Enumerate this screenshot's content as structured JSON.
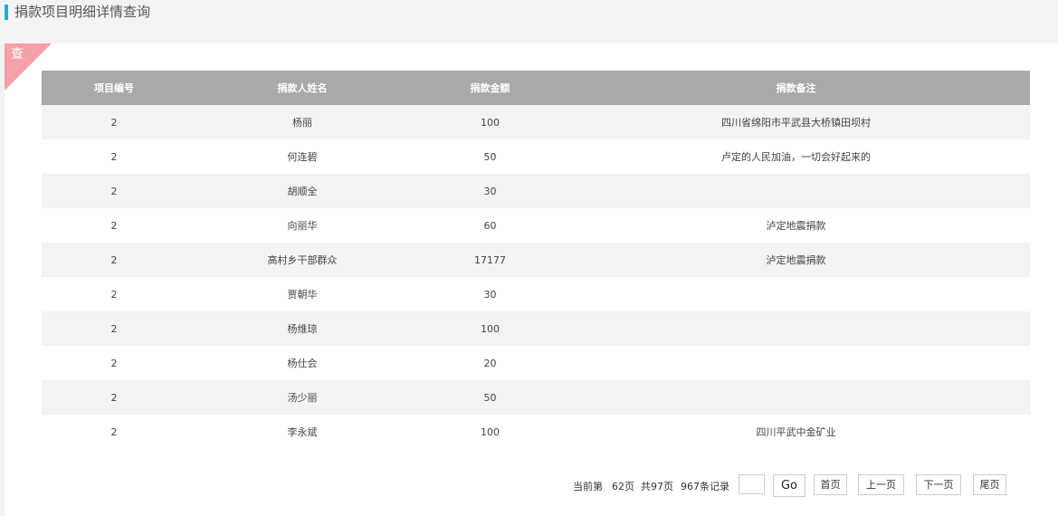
{
  "page": {
    "title": "捐款项目明细详情查询"
  },
  "panel": {
    "corner_label": "查"
  },
  "table": {
    "headers": [
      "项目编号",
      "捐款人姓名",
      "捐款金额",
      "捐款备注"
    ],
    "rows": [
      [
        "2",
        "杨丽",
        "100",
        "四川省绵阳市平武县大桥镇田坝村"
      ],
      [
        "2",
        "何连碧",
        "50",
        "卢定的人民加油，一切会好起来的"
      ],
      [
        "2",
        "胡顺全",
        "30",
        ""
      ],
      [
        "2",
        "向丽华",
        "60",
        "泸定地震捐款"
      ],
      [
        "2",
        "高村乡干部群众",
        "17177",
        "泸定地震捐款"
      ],
      [
        "2",
        "贾朝华",
        "30",
        ""
      ],
      [
        "2",
        "杨维琼",
        "100",
        ""
      ],
      [
        "2",
        "杨仕会",
        "20",
        ""
      ],
      [
        "2",
        "汤少丽",
        "50",
        ""
      ],
      [
        "2",
        "李永斌",
        "100",
        "四川平武中金矿业"
      ]
    ]
  },
  "pager": {
    "current_label": "当前第",
    "current_page": "62页",
    "total_pages": "共97页",
    "total_records": "967条记录",
    "page_input_value": "",
    "go_label": "Go",
    "first_label": "首页",
    "prev_label": "上一页",
    "next_label": "下一页",
    "last_label": "尾页"
  }
}
